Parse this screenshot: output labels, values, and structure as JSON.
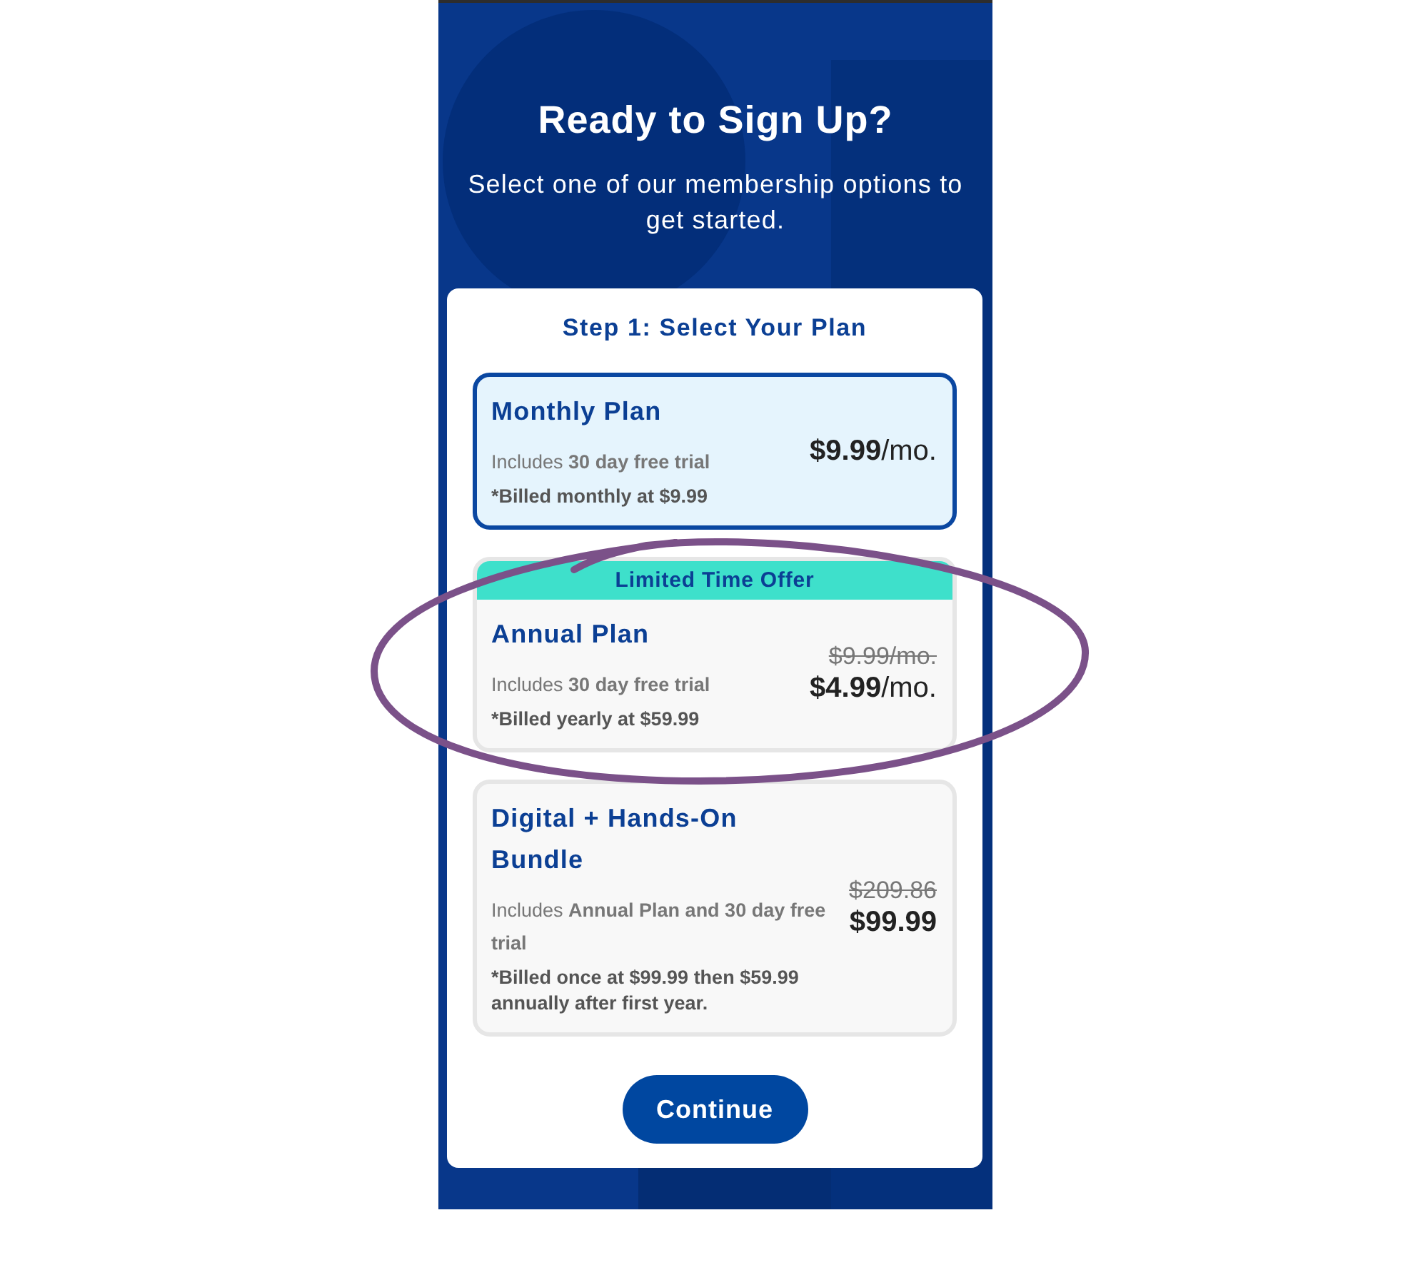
{
  "header": {
    "title": "Ready to Sign Up?",
    "subtitle": "Select one of our membership options to get started."
  },
  "step_title": "Step 1: Select Your Plan",
  "plans": [
    {
      "name": "Monthly Plan",
      "includes": "Includes **30 day free trial**",
      "billing": "*Billed monthly at $9.99",
      "price": {
        "amount": "$9.99",
        "unit": "/mo."
      },
      "selected": true,
      "circled": false
    },
    {
      "banner": "Limited Time Offer",
      "name": "Annual Plan",
      "includes": "Includes **30 day free trial**",
      "billing": "*Billed yearly at $59.99",
      "price": {
        "old": "$9.99/mo.",
        "amount": "$4.99",
        "unit": "/mo."
      },
      "selected": false,
      "circled": true
    },
    {
      "name": "Digital + Hands-On Bundle",
      "includes": "Includes **Annual Plan and 30 day free trial**",
      "billing": "*Billed once at $99.99 then $59.99 annually after first year.",
      "price": {
        "old": "$209.86",
        "amount": "$99.99"
      },
      "selected": false,
      "circled": false
    }
  ],
  "button": "Continue"
}
